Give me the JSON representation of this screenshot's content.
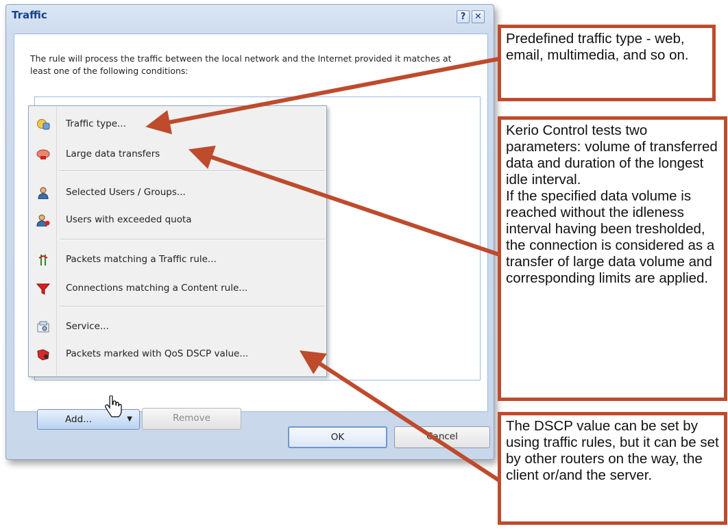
{
  "dialog": {
    "title": "Traffic",
    "help_label": "?",
    "close_label": "✕",
    "description": "The rule will process the traffic between the local network and the Internet provided it matches at least one of the following conditions:",
    "add_label": "Add...",
    "remove_label": "Remove",
    "ok_label": "OK",
    "cancel_label": "Cancel"
  },
  "menu": {
    "items": [
      {
        "label": "Traffic type...",
        "icon": "traffic-type-icon"
      },
      {
        "label": "Large data transfers",
        "icon": "large-data-icon"
      },
      {
        "label": "Selected Users / Groups...",
        "icon": "user-icon"
      },
      {
        "label": "Users with exceeded quota",
        "icon": "user-quota-icon"
      },
      {
        "label": "Packets matching a Traffic rule...",
        "icon": "traffic-rule-icon"
      },
      {
        "label": "Connections matching a Content rule...",
        "icon": "filter-funnel-icon"
      },
      {
        "label": "Service...",
        "icon": "service-icon"
      },
      {
        "label": "Packets marked with QoS DSCP value...",
        "icon": "dscp-icon"
      }
    ]
  },
  "callouts": {
    "c1": "Predefined traffic type - web, email, multimedia, and so on.",
    "c2": "Kerio Control tests two parameters: volume of transferred data and duration of the longest idle interval.\nIf the specified data volume is reached without  the idleness interval having been tresholded, the connection is considered as a transfer of large data volume and corresponding limits are applied.",
    "c3": "The DSCP value can be set by using traffic rules, but it can be set by other routers on the way, the client or/and the server."
  },
  "colors": {
    "callout_border": "#be4b2c",
    "title_text": "#15428b",
    "dialog_bg": "#cfdcee"
  }
}
